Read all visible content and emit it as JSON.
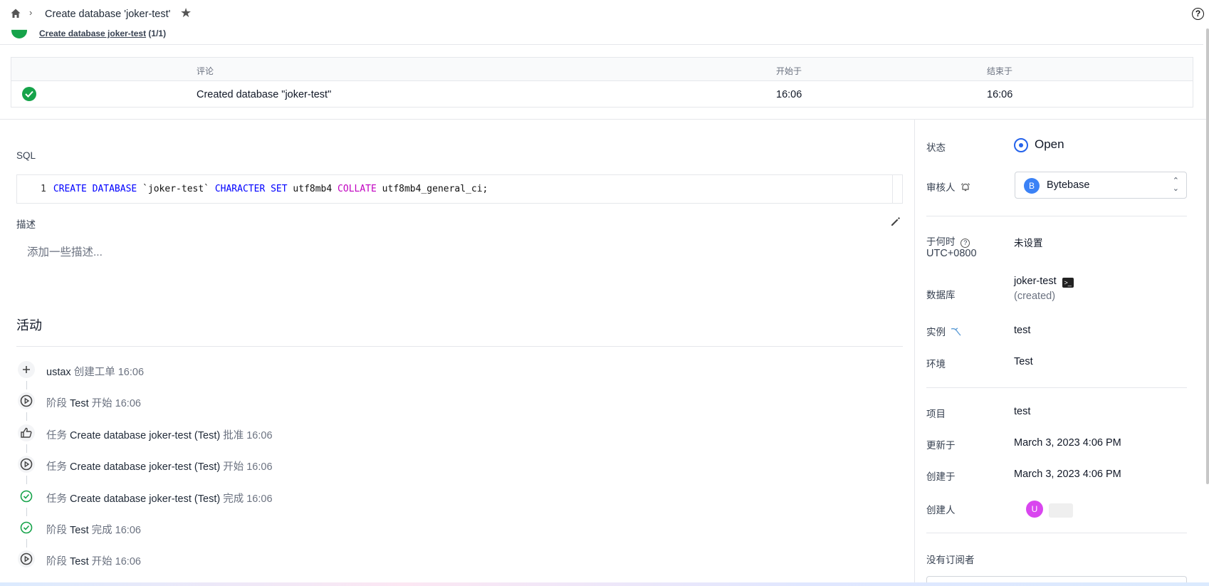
{
  "header": {
    "breadcrumb_title": "Create database 'joker-test'",
    "home_icon": "home-icon",
    "star_icon": "star-icon",
    "help_icon": "help-circle-icon"
  },
  "pipeline": {
    "stage_link": "Create database joker-test",
    "stage_count": "(1/1)"
  },
  "task_run_table": {
    "columns": [
      "评论",
      "开始于",
      "结束于"
    ],
    "rows": [
      {
        "status": "done",
        "comment": "Created database \"joker-test\"",
        "started": "16:06",
        "ended": "16:06"
      }
    ]
  },
  "sql": {
    "label": "SQL",
    "line_number": "1",
    "tokens": [
      "CREATE",
      "DATABASE",
      "`joker-test`",
      "CHARACTER",
      "SET",
      "utf8mb4",
      "COLLATE",
      "utf8mb4_general_ci;"
    ]
  },
  "description": {
    "label": "描述",
    "placeholder": "添加一些描述..."
  },
  "activity": {
    "title": "活动",
    "items": [
      {
        "icon": "plus-icon",
        "parts": [
          "ustax",
          " 创建工单 16:06"
        ]
      },
      {
        "icon": "play-circle-icon",
        "parts": [
          "阶段 ",
          "Test",
          " 开始 16:06"
        ]
      },
      {
        "icon": "thumbs-up-icon",
        "parts": [
          "任务 ",
          "Create database joker-test (Test)",
          " 批准 16:06"
        ]
      },
      {
        "icon": "play-circle-icon",
        "parts": [
          "任务 ",
          "Create database joker-test (Test)",
          " 开始 16:06"
        ]
      },
      {
        "icon": "check-circle-icon",
        "parts": [
          "任务 ",
          "Create database joker-test (Test)",
          " 完成 16:06"
        ]
      },
      {
        "icon": "check-circle-icon",
        "parts": [
          "阶段 ",
          "Test",
          " 完成 16:06"
        ]
      },
      {
        "icon": "play-circle-icon",
        "parts": [
          "阶段 ",
          "Test",
          " 开始 16:06"
        ]
      }
    ]
  },
  "sidebar": {
    "status_label": "状态",
    "status_value": "Open",
    "reviewer_label": "审核人",
    "reviewer_avatar": "B",
    "reviewer_name": "Bytebase",
    "when_label": "于何时",
    "timezone": "UTC+0800",
    "when_value": "未设置",
    "database_label": "数据库",
    "database_value": "joker-test",
    "database_note": "(created)",
    "instance_label": "实例",
    "instance_value": "test",
    "environment_label": "环境",
    "environment_value": "Test",
    "project_label": "项目",
    "project_value": "test",
    "updated_label": "更新于",
    "updated_value": "March 3, 2023 4:06 PM",
    "created_label": "创建于",
    "created_value": "March 3, 2023 4:06 PM",
    "creator_label": "创建人",
    "creator_avatar": "U",
    "subscribers_label": "没有订阅者"
  },
  "colors": {
    "accent": "#2563eb",
    "success": "#16a34a",
    "sql_keyword": "#0000ff",
    "sql_keyword2": "#c000c0"
  }
}
